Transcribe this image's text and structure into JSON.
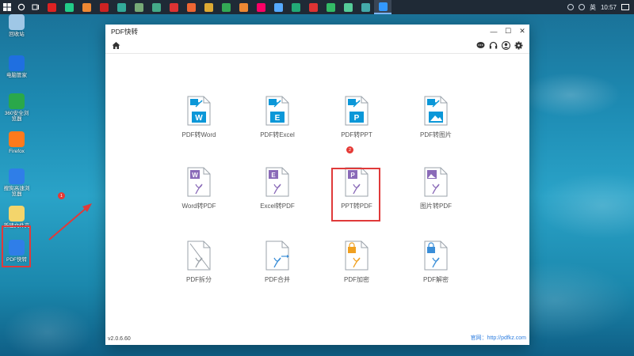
{
  "taskbar": {
    "tray_text": "英",
    "clock": "10:57",
    "apps": [
      "#d22",
      "#2c8",
      "#e83",
      "#c22",
      "#3a9",
      "#7a7",
      "#4a8",
      "#d33",
      "#e63",
      "#da3",
      "#3a5",
      "#e83",
      "#f06",
      "#5af",
      "#2a7",
      "#d33",
      "#3b6",
      "#5c9",
      "#4aa",
      "#39f"
    ]
  },
  "desktop": {
    "icons": [
      {
        "label": "回收站",
        "color": "#9fc7e6"
      },
      {
        "label": "电脑管家",
        "color": "#1f6fe0"
      },
      {
        "label": "360安全浏览器",
        "color": "#2aa84a"
      },
      {
        "label": "Firefox",
        "color": "#ff7a1c"
      },
      {
        "label": "搜狗高速浏览器",
        "color": "#2f7ee8"
      },
      {
        "label": "新建文件夹",
        "color": "#f4d56b"
      },
      {
        "label": "PDF快转",
        "color": "#2f7ee8"
      }
    ],
    "badge1": "1"
  },
  "window": {
    "title": "PDF快转",
    "version": "v2.0.6.60",
    "site": "官网：http://pdfkz.com",
    "badge2": "2"
  },
  "tiles": [
    {
      "label": "PDF转Word",
      "letter": "W",
      "color": "#0b97d8"
    },
    {
      "label": "PDF转Excel",
      "letter": "E",
      "color": "#0b97d8"
    },
    {
      "label": "PDF转PPT",
      "letter": "P",
      "color": "#0b97d8"
    },
    {
      "label": "PDF转图片",
      "letter": "",
      "color": "#0b97d8"
    },
    {
      "label": "Word转PDF",
      "letter": "W",
      "color": "#8a6ab8"
    },
    {
      "label": "Excel转PDF",
      "letter": "E",
      "color": "#8a6ab8"
    },
    {
      "label": "PPT转PDF",
      "letter": "P",
      "color": "#8a6ab8"
    },
    {
      "label": "图片转PDF",
      "letter": "",
      "color": "#8a6ab8"
    },
    {
      "label": "PDF拆分",
      "letter": "",
      "color": "#9aa1a8"
    },
    {
      "label": "PDF合并",
      "letter": "",
      "color": "#3a8ed8"
    },
    {
      "label": "PDF加密",
      "letter": "",
      "color": "#f0a020"
    },
    {
      "label": "PDF解密",
      "letter": "",
      "color": "#3a8ed8"
    }
  ]
}
